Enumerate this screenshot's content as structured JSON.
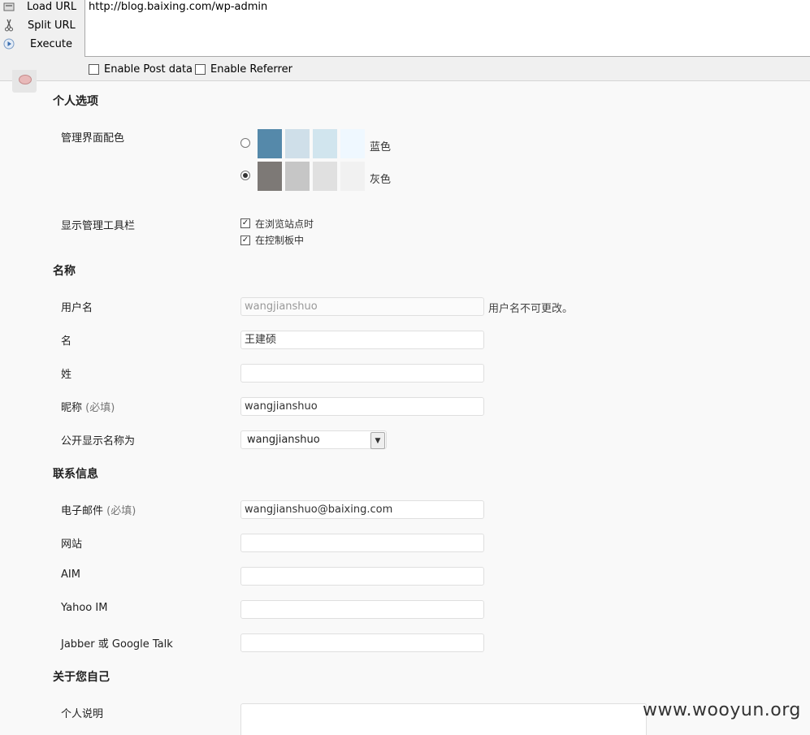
{
  "hackbar": {
    "load_url": "Load URL",
    "split_url": "Split URL",
    "execute": "Execute",
    "url_value": "http://blog.baixing.com/wp-admin",
    "enable_post": "Enable Post data",
    "enable_referrer": "Enable Referrer"
  },
  "personal": {
    "title": "个人选项",
    "color_scheme_label": "管理界面配色",
    "schemes": [
      {
        "name": "蓝色",
        "selected": false,
        "colors": [
          "#5589aa",
          "#cfdfe9",
          "#d1e5ee",
          "#eff8ff"
        ]
      },
      {
        "name": "灰色",
        "selected": true,
        "colors": [
          "#7d7976",
          "#c6c6c6",
          "#e0e0e0",
          "#f1f1f1"
        ]
      }
    ],
    "toolbar_label": "显示管理工具栏",
    "toolbar_options": [
      "在浏览站点时",
      "在控制板中"
    ]
  },
  "name": {
    "title": "名称",
    "username_label": "用户名",
    "username_value": "wangjianshuo",
    "username_desc": "用户名不可更改。",
    "first_label": "名",
    "first_value": "王建硕",
    "last_label": "姓",
    "last_value": "",
    "nickname_label": "昵称",
    "nickname_req": "(必填)",
    "nickname_value": "wangjianshuo",
    "display_label": "公开显示名称为",
    "display_value": "wangjianshuo"
  },
  "contact": {
    "title": "联系信息",
    "email_label": "电子邮件",
    "email_req": "(必填)",
    "email_value": "wangjianshuo@baixing.com",
    "website_label": "网站",
    "aim_label": "AIM",
    "yahoo_label": "Yahoo IM",
    "jabber_label": "Jabber 或 Google Talk"
  },
  "about": {
    "title": "关于您自己",
    "bio_label": "个人说明"
  },
  "watermark": "www.wooyun.org"
}
